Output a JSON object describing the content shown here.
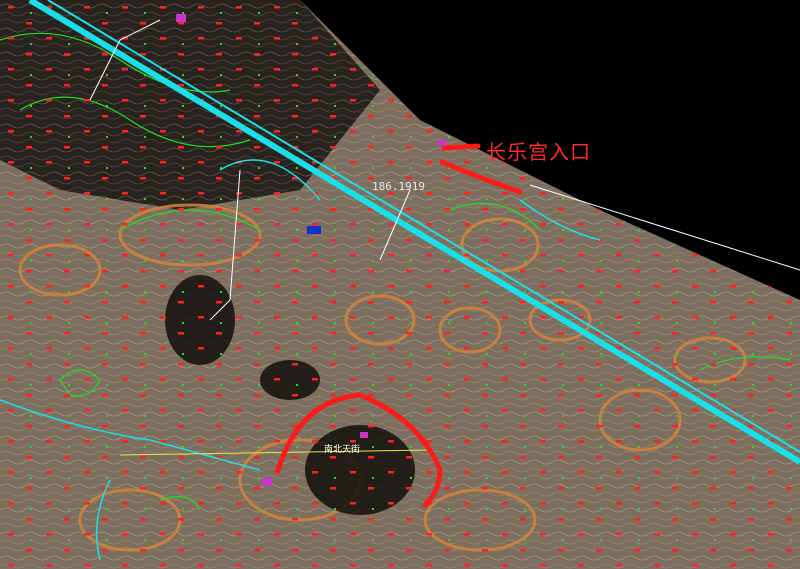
{
  "map": {
    "labels": {
      "entrance": "长乐宫入口",
      "elevation_readout": "186.1919",
      "area_name": "南北天街"
    },
    "colors": {
      "background": "#000000",
      "terrain": "#8a7a68",
      "contour_minor": "#c8b8a0",
      "contour_major": "#d4843a",
      "road": "#19e0e8",
      "boundary": "#ff1a1a",
      "vegetation": "#22dd22",
      "elevation_marker": "#ff2222",
      "annotation_line": "#ffffff"
    }
  }
}
